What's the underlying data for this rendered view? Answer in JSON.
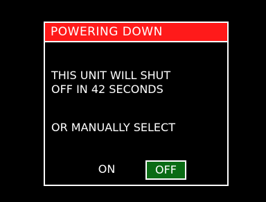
{
  "dialog": {
    "title": "POWERING DOWN",
    "message_line1": "THIS UNIT WILL SHUT",
    "message_line2": "OFF IN 42  SECONDS",
    "prompt": "OR MANUALLY SELECT",
    "options": {
      "on_label": "ON",
      "off_label": "OFF",
      "selected": "OFF"
    }
  },
  "colors": {
    "background": "#000000",
    "title_bar": "#ff1a1a",
    "selected_button": "#0a6b14",
    "text": "#ffffff"
  }
}
